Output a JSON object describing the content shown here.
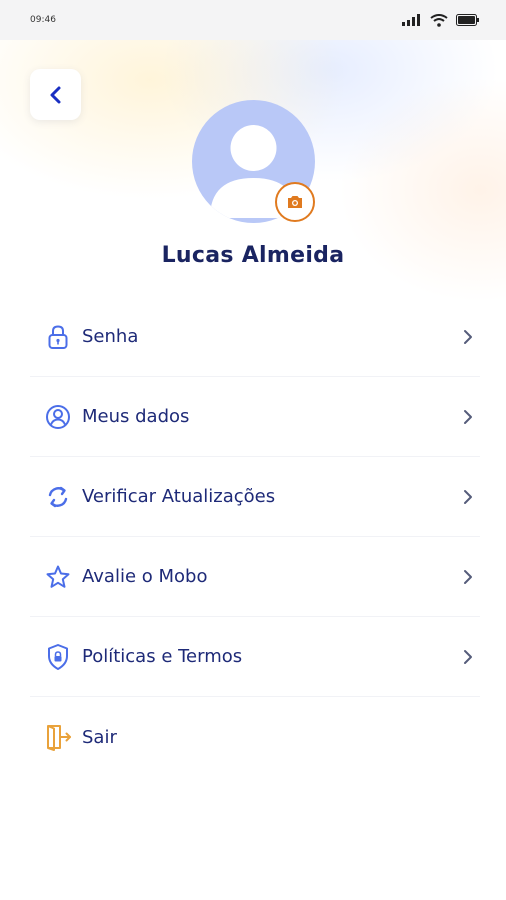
{
  "status_bar": {
    "time": "09:46"
  },
  "profile": {
    "name": "Lucas Almeida"
  },
  "menu": {
    "items": [
      {
        "label": "Senha",
        "icon": "lock-icon"
      },
      {
        "label": "Meus dados",
        "icon": "user-circle-icon"
      },
      {
        "label": "Verificar Atualizações",
        "icon": "refresh-icon"
      },
      {
        "label": "Avalie o Mobo",
        "icon": "star-icon"
      },
      {
        "label": "Políticas e Termos",
        "icon": "shield-icon"
      },
      {
        "label": "Sair",
        "icon": "logout-icon"
      }
    ]
  },
  "colors": {
    "primary": "#1e2a78",
    "icon_blue": "#4b6ee8",
    "accent_orange": "#e07a1f",
    "avatar_bg": "#b9c8f7"
  }
}
